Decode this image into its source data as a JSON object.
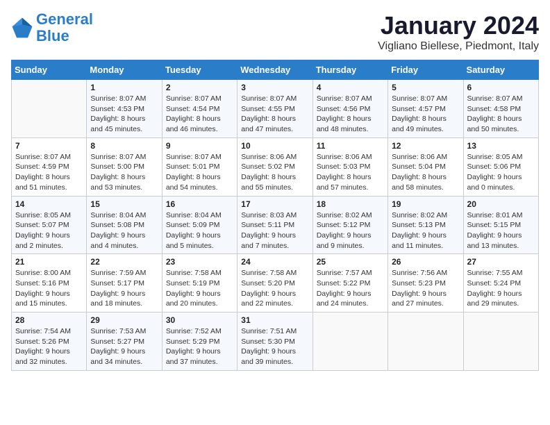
{
  "header": {
    "logo_line1": "General",
    "logo_line2": "Blue",
    "title": "January 2024",
    "subtitle": "Vigliano Biellese, Piedmont, Italy"
  },
  "days_of_week": [
    "Sunday",
    "Monday",
    "Tuesday",
    "Wednesday",
    "Thursday",
    "Friday",
    "Saturday"
  ],
  "weeks": [
    [
      {
        "num": "",
        "info": ""
      },
      {
        "num": "1",
        "info": "Sunrise: 8:07 AM\nSunset: 4:53 PM\nDaylight: 8 hours\nand 45 minutes."
      },
      {
        "num": "2",
        "info": "Sunrise: 8:07 AM\nSunset: 4:54 PM\nDaylight: 8 hours\nand 46 minutes."
      },
      {
        "num": "3",
        "info": "Sunrise: 8:07 AM\nSunset: 4:55 PM\nDaylight: 8 hours\nand 47 minutes."
      },
      {
        "num": "4",
        "info": "Sunrise: 8:07 AM\nSunset: 4:56 PM\nDaylight: 8 hours\nand 48 minutes."
      },
      {
        "num": "5",
        "info": "Sunrise: 8:07 AM\nSunset: 4:57 PM\nDaylight: 8 hours\nand 49 minutes."
      },
      {
        "num": "6",
        "info": "Sunrise: 8:07 AM\nSunset: 4:58 PM\nDaylight: 8 hours\nand 50 minutes."
      }
    ],
    [
      {
        "num": "7",
        "info": "Sunrise: 8:07 AM\nSunset: 4:59 PM\nDaylight: 8 hours\nand 51 minutes."
      },
      {
        "num": "8",
        "info": "Sunrise: 8:07 AM\nSunset: 5:00 PM\nDaylight: 8 hours\nand 53 minutes."
      },
      {
        "num": "9",
        "info": "Sunrise: 8:07 AM\nSunset: 5:01 PM\nDaylight: 8 hours\nand 54 minutes."
      },
      {
        "num": "10",
        "info": "Sunrise: 8:06 AM\nSunset: 5:02 PM\nDaylight: 8 hours\nand 55 minutes."
      },
      {
        "num": "11",
        "info": "Sunrise: 8:06 AM\nSunset: 5:03 PM\nDaylight: 8 hours\nand 57 minutes."
      },
      {
        "num": "12",
        "info": "Sunrise: 8:06 AM\nSunset: 5:04 PM\nDaylight: 8 hours\nand 58 minutes."
      },
      {
        "num": "13",
        "info": "Sunrise: 8:05 AM\nSunset: 5:06 PM\nDaylight: 9 hours\nand 0 minutes."
      }
    ],
    [
      {
        "num": "14",
        "info": "Sunrise: 8:05 AM\nSunset: 5:07 PM\nDaylight: 9 hours\nand 2 minutes."
      },
      {
        "num": "15",
        "info": "Sunrise: 8:04 AM\nSunset: 5:08 PM\nDaylight: 9 hours\nand 4 minutes."
      },
      {
        "num": "16",
        "info": "Sunrise: 8:04 AM\nSunset: 5:09 PM\nDaylight: 9 hours\nand 5 minutes."
      },
      {
        "num": "17",
        "info": "Sunrise: 8:03 AM\nSunset: 5:11 PM\nDaylight: 9 hours\nand 7 minutes."
      },
      {
        "num": "18",
        "info": "Sunrise: 8:02 AM\nSunset: 5:12 PM\nDaylight: 9 hours\nand 9 minutes."
      },
      {
        "num": "19",
        "info": "Sunrise: 8:02 AM\nSunset: 5:13 PM\nDaylight: 9 hours\nand 11 minutes."
      },
      {
        "num": "20",
        "info": "Sunrise: 8:01 AM\nSunset: 5:15 PM\nDaylight: 9 hours\nand 13 minutes."
      }
    ],
    [
      {
        "num": "21",
        "info": "Sunrise: 8:00 AM\nSunset: 5:16 PM\nDaylight: 9 hours\nand 15 minutes."
      },
      {
        "num": "22",
        "info": "Sunrise: 7:59 AM\nSunset: 5:17 PM\nDaylight: 9 hours\nand 18 minutes."
      },
      {
        "num": "23",
        "info": "Sunrise: 7:58 AM\nSunset: 5:19 PM\nDaylight: 9 hours\nand 20 minutes."
      },
      {
        "num": "24",
        "info": "Sunrise: 7:58 AM\nSunset: 5:20 PM\nDaylight: 9 hours\nand 22 minutes."
      },
      {
        "num": "25",
        "info": "Sunrise: 7:57 AM\nSunset: 5:22 PM\nDaylight: 9 hours\nand 24 minutes."
      },
      {
        "num": "26",
        "info": "Sunrise: 7:56 AM\nSunset: 5:23 PM\nDaylight: 9 hours\nand 27 minutes."
      },
      {
        "num": "27",
        "info": "Sunrise: 7:55 AM\nSunset: 5:24 PM\nDaylight: 9 hours\nand 29 minutes."
      }
    ],
    [
      {
        "num": "28",
        "info": "Sunrise: 7:54 AM\nSunset: 5:26 PM\nDaylight: 9 hours\nand 32 minutes."
      },
      {
        "num": "29",
        "info": "Sunrise: 7:53 AM\nSunset: 5:27 PM\nDaylight: 9 hours\nand 34 minutes."
      },
      {
        "num": "30",
        "info": "Sunrise: 7:52 AM\nSunset: 5:29 PM\nDaylight: 9 hours\nand 37 minutes."
      },
      {
        "num": "31",
        "info": "Sunrise: 7:51 AM\nSunset: 5:30 PM\nDaylight: 9 hours\nand 39 minutes."
      },
      {
        "num": "",
        "info": ""
      },
      {
        "num": "",
        "info": ""
      },
      {
        "num": "",
        "info": ""
      }
    ]
  ]
}
